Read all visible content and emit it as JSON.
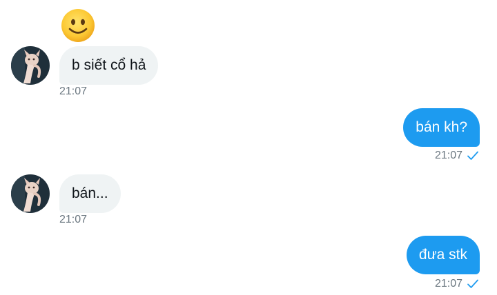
{
  "conversation": {
    "reaction_emoji": "slightly-smiling-face",
    "messages": [
      {
        "direction": "in",
        "text": "b siết cổ hả",
        "time": "21:07"
      },
      {
        "direction": "out",
        "text": "bán kh?",
        "time": "21:07",
        "status": "sent"
      },
      {
        "direction": "in",
        "text": "bán...",
        "time": "21:07"
      },
      {
        "direction": "out",
        "text": "đưa stk",
        "time": "21:07",
        "status": "sent"
      }
    ]
  },
  "colors": {
    "incoming_bubble": "#eff3f4",
    "outgoing_bubble": "#1d9bf0",
    "timestamp": "#6b7780",
    "check": "#1d9bf0"
  },
  "icons": {
    "avatar": "sphynx-cat-avatar",
    "read_receipt": "checkmark-icon"
  }
}
